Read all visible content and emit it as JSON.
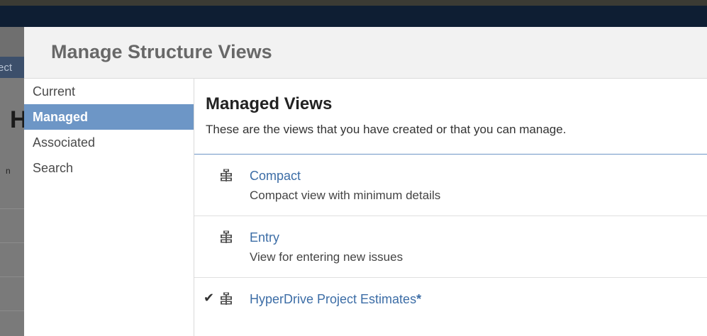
{
  "background": {
    "subnav_fragment": "ect",
    "heading_fragment": "H",
    "small_fragment": "n"
  },
  "dialog": {
    "title": "Manage Structure Views"
  },
  "sidebar": {
    "items": [
      {
        "label": "Current",
        "active": false
      },
      {
        "label": "Managed",
        "active": true
      },
      {
        "label": "Associated",
        "active": false
      },
      {
        "label": "Search",
        "active": false
      }
    ]
  },
  "main": {
    "title": "Managed Views",
    "description": "These are the views that you have created or that you can manage.",
    "views": [
      {
        "name": "Compact",
        "description": "Compact view with minimum details",
        "checked": false,
        "modified": false,
        "icon": "structure-view-icon"
      },
      {
        "name": "Entry",
        "description": "View for entering new issues",
        "checked": false,
        "modified": false,
        "icon": "structure-view-icon"
      },
      {
        "name": "HyperDrive Project Estimates",
        "description": "",
        "checked": true,
        "modified": true,
        "modified_marker": "*",
        "check_glyph": "✔",
        "icon": "structure-view-icon"
      }
    ]
  },
  "colors": {
    "accent": "#6d96c6",
    "link": "#3c6da6",
    "topbar": "#0e1e33"
  }
}
